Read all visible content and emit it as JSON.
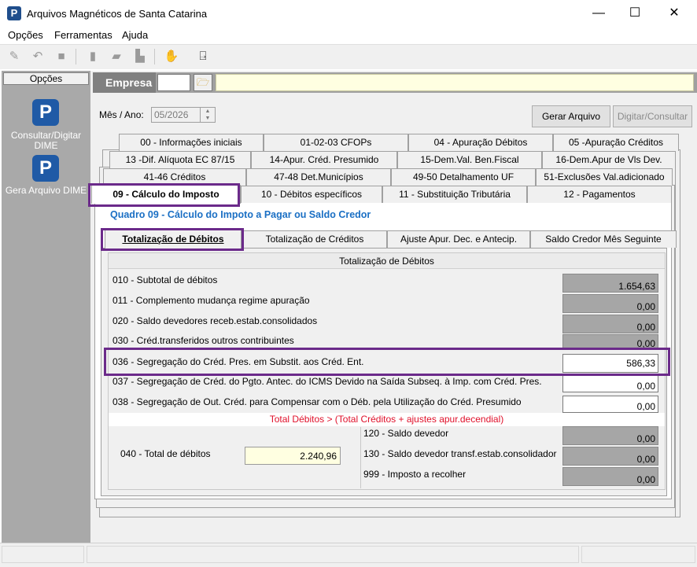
{
  "window": {
    "title": "Arquivos Magnéticos de Santa Catarina",
    "icon_letter": "P",
    "minimize": "—",
    "maximize": "☐",
    "close": "✕"
  },
  "menu": [
    "Opções",
    "Ferramentas",
    "Ajuda"
  ],
  "sidebar": {
    "header": "Opções",
    "items": [
      {
        "label": "Consultar/Digitar DIME",
        "icon": "p-logo-icon"
      },
      {
        "label": "Gera Arquivo DIME",
        "icon": "p-logo-icon"
      }
    ]
  },
  "empresa": {
    "label": "Empresa",
    "code": "",
    "name": ""
  },
  "mes_ano": {
    "label": "Mês / Ano:",
    "value": "05/2026"
  },
  "buttons": {
    "gerar": "Gerar Arquivo",
    "digitar": "Digitar/Consultar"
  },
  "tabs": {
    "row1": [
      "00 - Informações iniciais",
      "01-02-03   CFOPs",
      "04 - Apuração Débitos",
      "05 -Apuração Créditos"
    ],
    "row2": [
      "13 -Dif. Alíquota EC 87/15",
      "14-Apur. Créd. Presumido",
      "15-Dem.Val. Ben.Fiscal",
      "16-Dem.Apur de Vls Dev."
    ],
    "row3": [
      "41-46   Créditos",
      "47-48   Det.Municípios",
      "49-50   Detalhamento UF",
      "51-Exclusões Val.adicionado"
    ],
    "row4": [
      "09 - Cálculo do Imposto",
      "10 - Débitos específicos",
      "11 - Substituição Tributária",
      "12 - Pagamentos"
    ]
  },
  "quadro_title": "Quadro 09 - Cálculo do Impoto a Pagar ou Saldo Credor",
  "subtabs": [
    "Totalização de Débitos",
    "Totalização de Créditos",
    "Ajuste Apur. Dec. e Antecip.",
    "Saldo Credor Mês Seguinte"
  ],
  "section_header": "Totalização de Débitos",
  "rows": [
    {
      "label": "010 - Subtotal de débitos",
      "value": "1.654,63"
    },
    {
      "label": "011 - Complemento mudança regime apuração",
      "value": "0,00"
    },
    {
      "label": "020 - Saldo devedores receb.estab.consolidados",
      "value": "0,00"
    },
    {
      "label": "030 - Créd.transferidos outros contribuintes",
      "value": "0,00"
    },
    {
      "label": "036 - Segregação do Créd. Pres. em Substit. aos Créd. Ent.",
      "value": "586,33"
    },
    {
      "label": "037 - Segregação de Créd. do Pgto. Antec. do ICMS Devido na Saída Subseq. à Imp. com Créd. Pres.",
      "value": "0,00"
    },
    {
      "label": "038 - Segregação de Out. Créd. para Compensar com o Déb. pela Utilização do Créd. Presumido",
      "value": "0,00"
    }
  ],
  "warning": "Total Débitos > (Total Créditos + ajustes apur.decendial)",
  "total": {
    "label": "040 - Total de débitos",
    "value": "2.240,96"
  },
  "summary": [
    {
      "label": "120 - Saldo devedor",
      "value": "0,00"
    },
    {
      "label": "130 - Saldo devedor transf.estab.consolidador",
      "value": "0,00"
    },
    {
      "label": "999 - Imposto a recolher",
      "value": "0,00"
    }
  ],
  "colors": {
    "highlight": "#6b2a8a",
    "link_blue": "#1a6fc4",
    "warning_red": "#e0102a",
    "readonly_gray": "#a6a6a6",
    "editable_yellow": "#ffffe1"
  }
}
